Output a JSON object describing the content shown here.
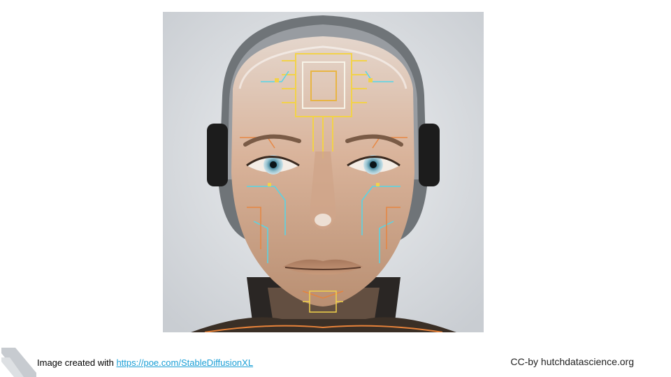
{
  "slide": {
    "image": {
      "alt": "AI generated portrait of a translucent cyborg face with circuit patterns",
      "background_color": "#e3e6ea",
      "skin_color": "#d9b39a",
      "circuit_colors": [
        "#f2d24a",
        "#54d6e8",
        "#e8833a",
        "#f7f4e8"
      ]
    },
    "caption": {
      "prefix": "Image created with ",
      "link_text": "https://poe.com/StableDiffusionXL",
      "link_color": "#1a9fd6"
    },
    "license": "CC-by hutchdatascience.org",
    "logo_icon": "hutch-chevron-logo-icon"
  }
}
